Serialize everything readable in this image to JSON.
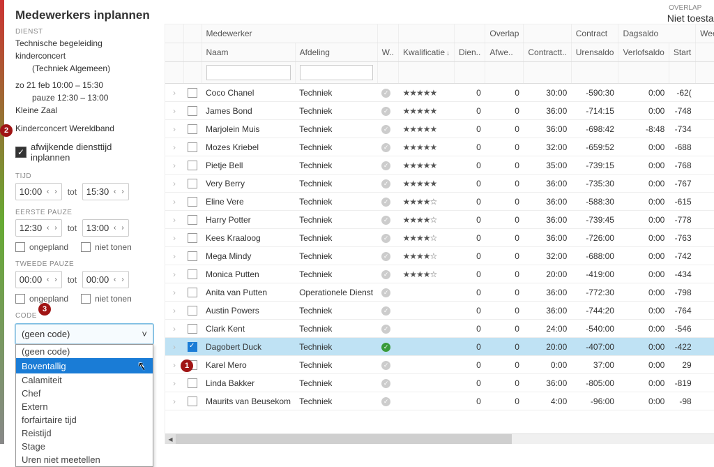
{
  "title": "Medewerkers inplannen",
  "sidebar": {
    "dienst_lbl": "DIENST",
    "dienst_naam": "Technische begeleiding kinderconcert",
    "dienst_cat": "(Techniek Algemeen)",
    "tijd1": "zo 21 feb 10:00 – 15:30",
    "pauze": "pauze 12:30 – 13:00",
    "zaal": "Kleine Zaal",
    "concert": "Kinderconcert Wereldband",
    "afwijkend_cb": "afwijkende diensttijd inplannen",
    "tijd_lbl": "TIJD",
    "tijd_van": "10:00",
    "tijd_tot": "15:30",
    "tot": "tot",
    "p1_lbl": "EERSTE PAUZE",
    "p1_van": "12:30",
    "p1_tot": "13:00",
    "p2_lbl": "TWEEDE PAUZE",
    "p2_van": "00:00",
    "p2_tot": "00:00",
    "ongepland": "ongepland",
    "niet_tonen": "niet tonen",
    "code_lbl": "CODE",
    "code_val": "(geen code)",
    "code_opts": [
      "(geen code)",
      "Boventallig",
      "Calamiteit",
      "Chef",
      "Extern",
      "forfairtaire tijd",
      "Reistijd",
      "Stage",
      "Uren niet meetellen"
    ]
  },
  "overlap": {
    "lbl": "OVERLAP",
    "val": "Niet toestaan"
  },
  "headers": {
    "h1": [
      "",
      "",
      "Medewerker",
      "",
      "",
      "",
      "",
      "Overlap",
      "",
      "Contract",
      "Dagsaldo",
      "",
      "Weeksaldo"
    ],
    "h2": [
      "",
      "",
      "Naam",
      "Afdeling",
      "W..",
      "Kwalificatie",
      "Dien..",
      "Afwe..",
      "Contractt..",
      "Urensaldo",
      "Verlofsaldo",
      "Start",
      ""
    ]
  },
  "rows": [
    {
      "naam": "Coco Chanel",
      "afd": "Techniek",
      "stars": 5,
      "dien": 0,
      "afw": 0,
      "ct": "30:00",
      "uren": "-590:30",
      "verlof": "0:00",
      "start": "-62(",
      "sel": false,
      "w": true
    },
    {
      "naam": "James Bond",
      "afd": "Techniek",
      "stars": 5,
      "dien": 0,
      "afw": 0,
      "ct": "36:00",
      "uren": "-714:15",
      "verlof": "0:00",
      "start": "-748",
      "sel": false,
      "w": true
    },
    {
      "naam": "Marjolein Muis",
      "afd": "Techniek",
      "stars": 5,
      "dien": 0,
      "afw": 0,
      "ct": "36:00",
      "uren": "-698:42",
      "verlof": "-8:48",
      "start": "-734",
      "sel": false,
      "w": true
    },
    {
      "naam": "Mozes Kriebel",
      "afd": "Techniek",
      "stars": 5,
      "dien": 0,
      "afw": 0,
      "ct": "32:00",
      "uren": "-659:52",
      "verlof": "0:00",
      "start": "-688",
      "sel": false,
      "w": true
    },
    {
      "naam": "Pietje Bell",
      "afd": "Techniek",
      "stars": 5,
      "dien": 0,
      "afw": 0,
      "ct": "35:00",
      "uren": "-739:15",
      "verlof": "0:00",
      "start": "-768",
      "sel": false,
      "w": true
    },
    {
      "naam": "Very Berry",
      "afd": "Techniek",
      "stars": 5,
      "dien": 0,
      "afw": 0,
      "ct": "36:00",
      "uren": "-735:30",
      "verlof": "0:00",
      "start": "-767",
      "sel": false,
      "w": true
    },
    {
      "naam": "Eline Vere",
      "afd": "Techniek",
      "stars": 4,
      "dien": 0,
      "afw": 0,
      "ct": "36:00",
      "uren": "-588:30",
      "verlof": "0:00",
      "start": "-615",
      "sel": false,
      "w": true
    },
    {
      "naam": "Harry Potter",
      "afd": "Techniek",
      "stars": 4,
      "dien": 0,
      "afw": 0,
      "ct": "36:00",
      "uren": "-739:45",
      "verlof": "0:00",
      "start": "-778",
      "sel": false,
      "w": true
    },
    {
      "naam": "Kees Kraaloog",
      "afd": "Techniek",
      "stars": 4,
      "dien": 0,
      "afw": 0,
      "ct": "36:00",
      "uren": "-726:00",
      "verlof": "0:00",
      "start": "-763",
      "sel": false,
      "w": true
    },
    {
      "naam": "Mega Mindy",
      "afd": "Techniek",
      "stars": 4,
      "dien": 0,
      "afw": 0,
      "ct": "32:00",
      "uren": "-688:00",
      "verlof": "0:00",
      "start": "-742",
      "sel": false,
      "w": true
    },
    {
      "naam": "Monica Putten",
      "afd": "Techniek",
      "stars": 4,
      "dien": 0,
      "afw": 0,
      "ct": "20:00",
      "uren": "-419:00",
      "verlof": "0:00",
      "start": "-434",
      "sel": false,
      "w": true
    },
    {
      "naam": "Anita van Putten",
      "afd": "Operationele Dienst",
      "stars": 0,
      "dien": 0,
      "afw": 0,
      "ct": "36:00",
      "uren": "-772:30",
      "verlof": "0:00",
      "start": "-798",
      "sel": false,
      "w": true
    },
    {
      "naam": "Austin Powers",
      "afd": "Techniek",
      "stars": 0,
      "dien": 0,
      "afw": 0,
      "ct": "36:00",
      "uren": "-744:20",
      "verlof": "0:00",
      "start": "-764",
      "sel": false,
      "w": true
    },
    {
      "naam": "Clark Kent",
      "afd": "Techniek",
      "stars": 0,
      "dien": 0,
      "afw": 0,
      "ct": "24:00",
      "uren": "-540:00",
      "verlof": "0:00",
      "start": "-546",
      "sel": false,
      "w": true
    },
    {
      "naam": "Dagobert Duck",
      "afd": "Techniek",
      "stars": 0,
      "dien": 0,
      "afw": 0,
      "ct": "20:00",
      "uren": "-407:00",
      "verlof": "0:00",
      "start": "-422",
      "sel": true,
      "w": true,
      "won": true
    },
    {
      "naam": "Karel Mero",
      "afd": "Techniek",
      "stars": 0,
      "dien": 0,
      "afw": 0,
      "ct": "0:00",
      "uren": "37:00",
      "verlof": "0:00",
      "start": "29",
      "sel": false,
      "w": true
    },
    {
      "naam": "Linda Bakker",
      "afd": "Techniek",
      "stars": 0,
      "dien": 0,
      "afw": 0,
      "ct": "36:00",
      "uren": "-805:00",
      "verlof": "0:00",
      "start": "-819",
      "sel": false,
      "w": true
    },
    {
      "naam": "Maurits van Beusekom",
      "afd": "Techniek",
      "stars": 0,
      "dien": 0,
      "afw": 0,
      "ct": "4:00",
      "uren": "-96:00",
      "verlof": "0:00",
      "start": "-98",
      "sel": false,
      "w": true
    }
  ],
  "badges": {
    "b1": "1",
    "b2": "2",
    "b3": "3"
  }
}
